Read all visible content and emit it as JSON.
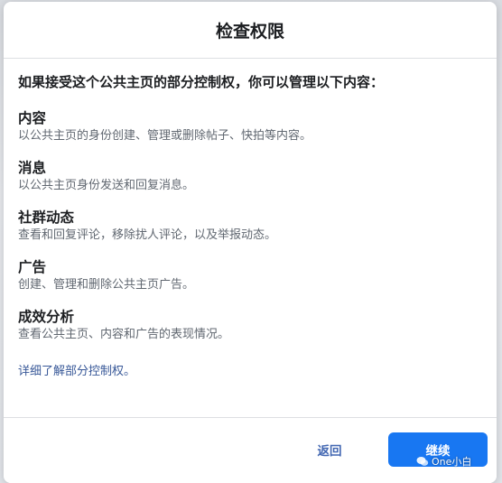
{
  "dialog": {
    "title": "检查权限",
    "intro": "如果接受这个公共主页的部分控制权，你可以管理以下内容：",
    "permissions": [
      {
        "title": "内容",
        "description": "以公共主页的身份创建、管理或删除帖子、快拍等内容。"
      },
      {
        "title": "消息",
        "description": "以公共主页身份发送和回复消息。"
      },
      {
        "title": "社群动态",
        "description": "查看和回复评论，移除扰人评论，以及举报动态。"
      },
      {
        "title": "广告",
        "description": "创建、管理和删除公共主页广告。"
      },
      {
        "title": "成效分析",
        "description": "查看公共主页、内容和广告的表现情况。"
      }
    ],
    "learn_more": "详细了解部分控制权。"
  },
  "footer": {
    "back_label": "返回",
    "continue_label": "继续"
  },
  "watermark": {
    "text": "One小白",
    "icon": "wechat-icon"
  },
  "colors": {
    "accent": "#1877f2",
    "link": "#385898",
    "back_text": "#4267b2",
    "title_text": "#1c1e21",
    "secondary_text": "#606770"
  }
}
